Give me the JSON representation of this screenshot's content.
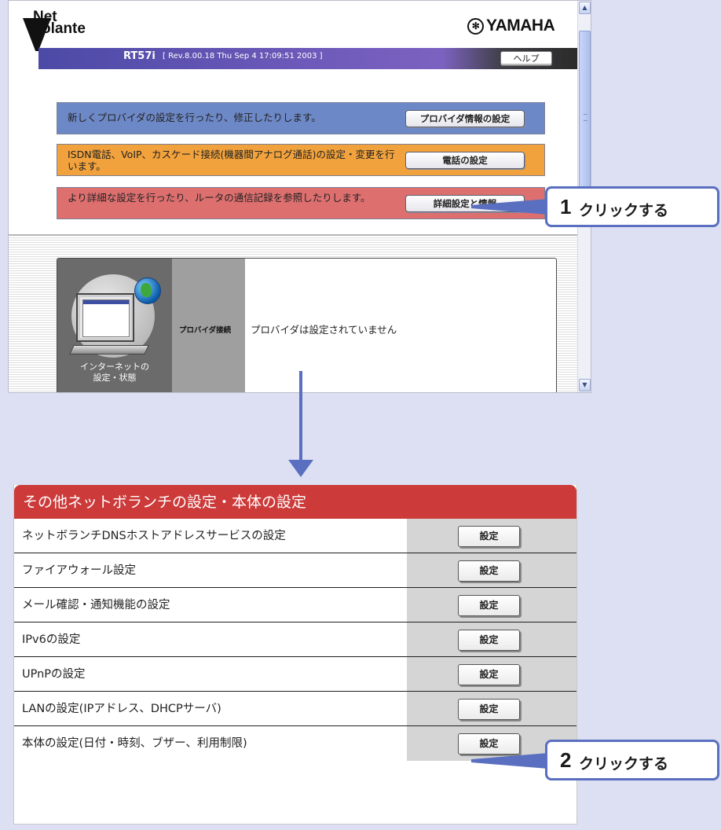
{
  "top_window": {
    "logo": {
      "line1": "Net",
      "line2": "olante"
    },
    "brand": "YAMAHA",
    "titlebar": {
      "model": "RT57i",
      "revision": "[ Rev.8.00.18 Thu Sep 4 17:09:51 2003 ]",
      "help_button": "ヘルプ"
    },
    "menu": [
      {
        "text": "新しくプロバイダの設定を行ったり、修正したりします。",
        "button": "プロバイダ情報の設定",
        "color": "#6d88c6"
      },
      {
        "text": "ISDN電話、VoIP、カスケード接続(機器間アナログ通話)の設定・変更を行います。",
        "button": "電話の設定",
        "color": "#f2a23c"
      },
      {
        "text": "より詳細な設定を行ったり、ルータの通信記録を参照したりします。",
        "button": "詳細設定と情報",
        "color": "#dd6f6f"
      }
    ],
    "status": {
      "internet_label_line1": "インターネットの",
      "internet_label_line2": "設定・状態",
      "provider_label": "プロバイダ接続",
      "provider_text": "プロバイダは設定されていません"
    }
  },
  "callouts": [
    {
      "number": "1",
      "text": "クリックする"
    },
    {
      "number": "2",
      "text": "クリックする"
    }
  ],
  "settings_panel": {
    "header": "その他ネットボランチの設定・本体の設定",
    "rows": [
      {
        "label": "ネットボランチDNSホストアドレスサービスの設定",
        "button": "設定"
      },
      {
        "label": "ファイアウォール設定",
        "button": "設定"
      },
      {
        "label": "メール確認・通知機能の設定",
        "button": "設定"
      },
      {
        "label": "IPv6の設定",
        "button": "設定"
      },
      {
        "label": "UPnPの設定",
        "button": "設定"
      },
      {
        "label": "LANの設定(IPアドレス、DHCPサーバ)",
        "button": "設定"
      },
      {
        "label": "本体の設定(日付・時刻、ブザー、利用制限)",
        "button": "設定"
      }
    ]
  },
  "colors": {
    "accent": "#5a6fc0",
    "header_red": "#cc3a3a",
    "titlebar_purple": "#6a58b8"
  }
}
